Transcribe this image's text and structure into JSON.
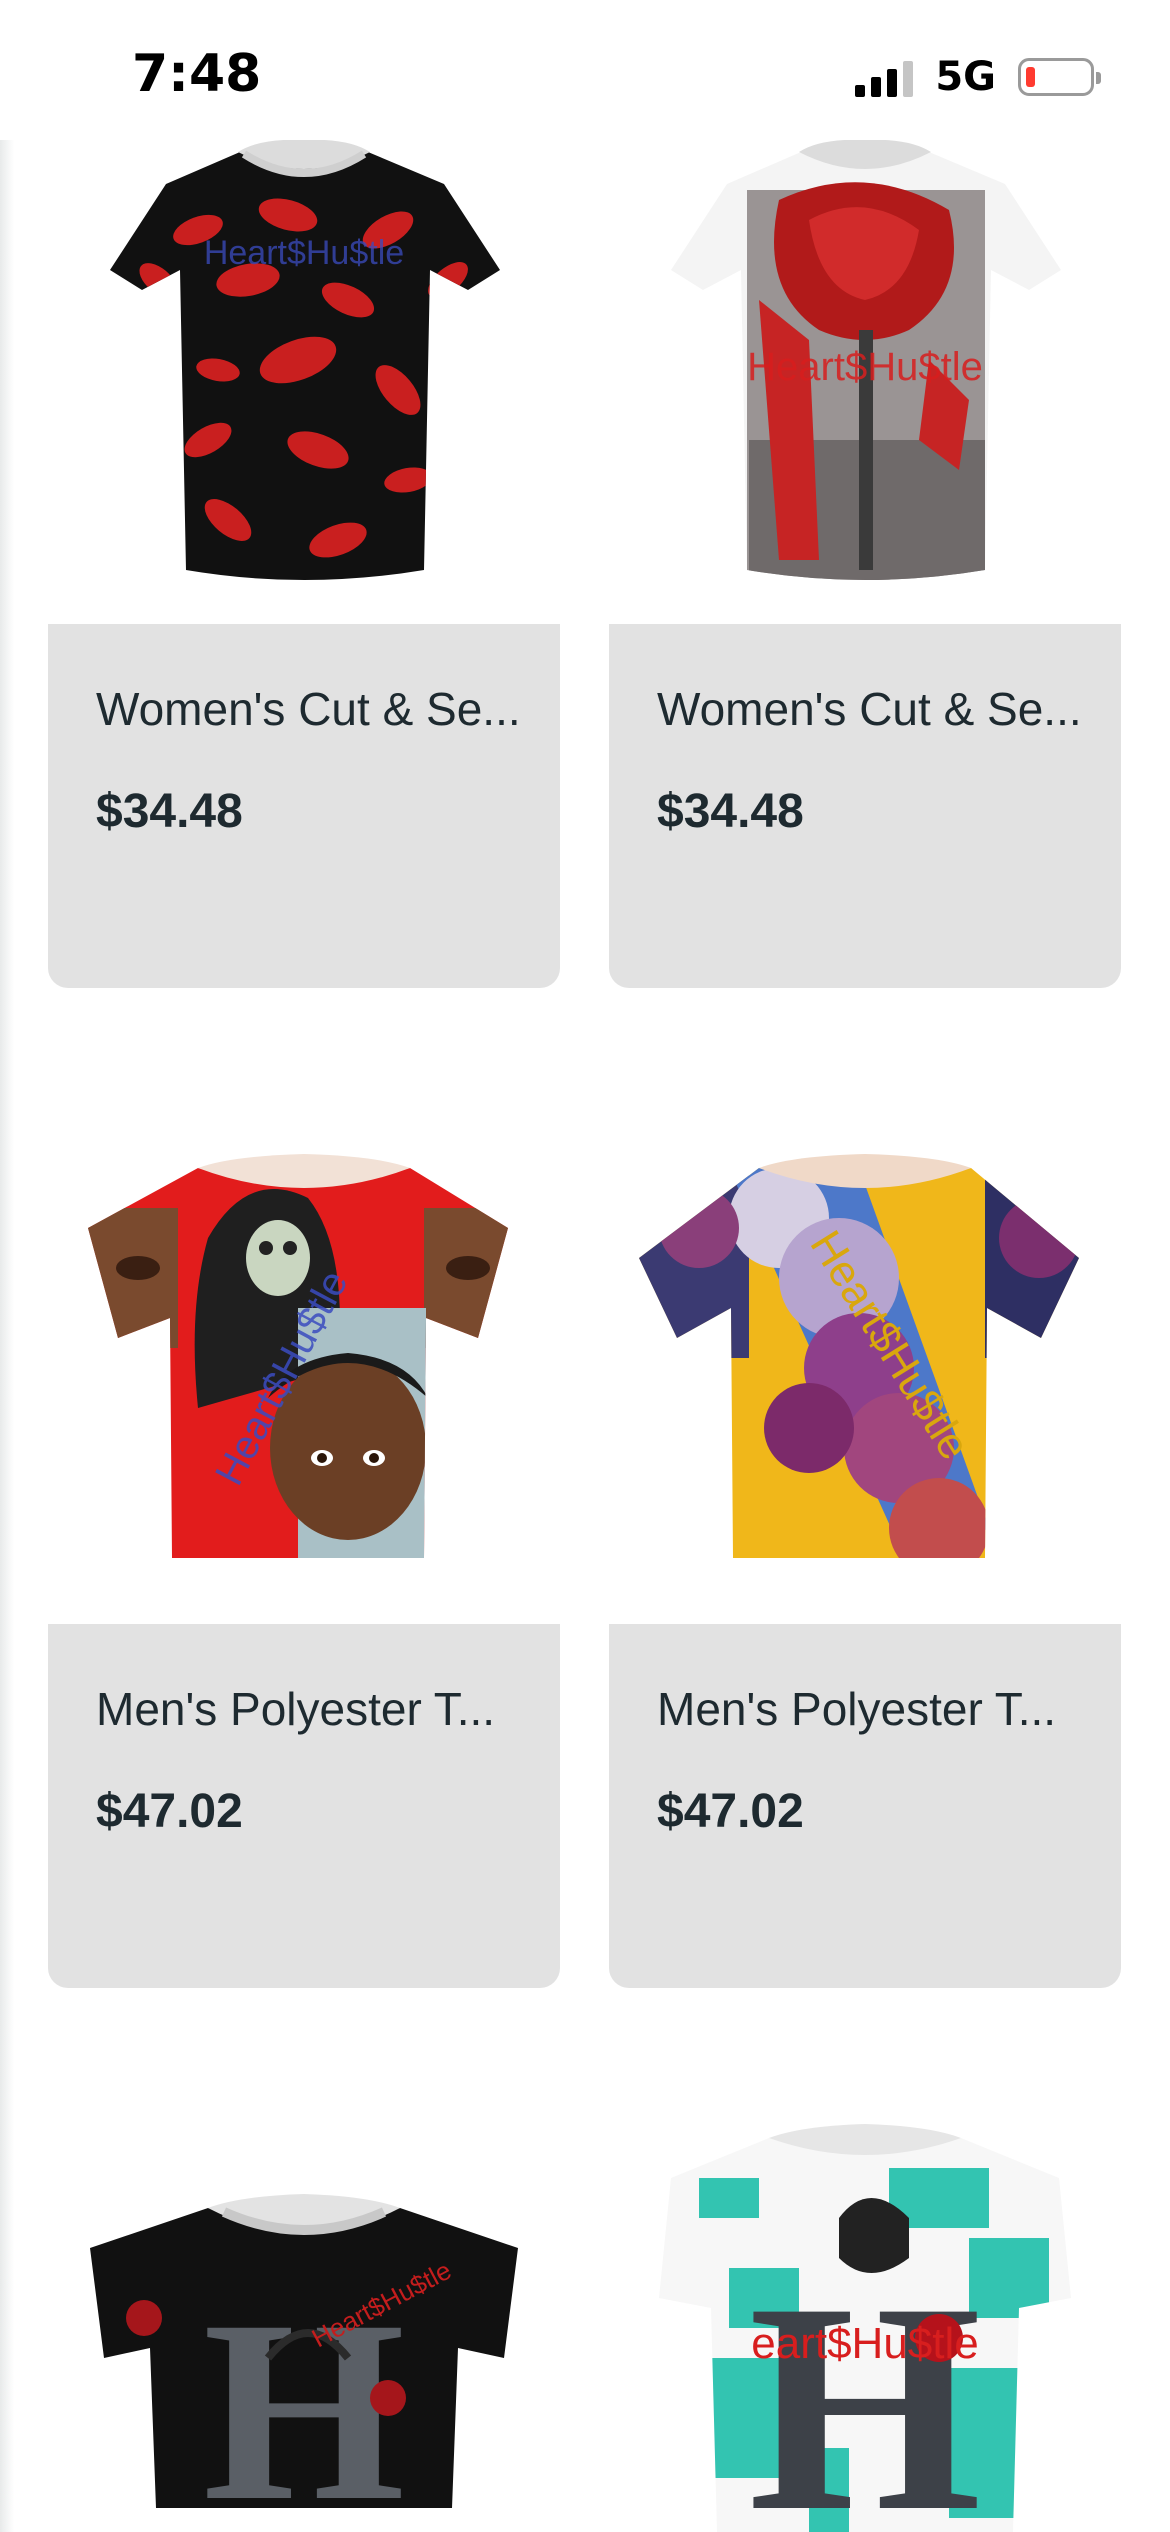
{
  "status_bar": {
    "time": "7:48",
    "network": "5G",
    "signal_bars": 3,
    "battery_level": 0.1,
    "icons": [
      "signal-icon",
      "battery-icon"
    ]
  },
  "products": [
    {
      "title": "Women's Cut & Se...",
      "price": "$34.48",
      "image": "red-lips-womens-tshirt",
      "print_text": "Heart$Hu$tle"
    },
    {
      "title": "Women's Cut & Se...",
      "price": "$34.48",
      "image": "red-rose-womens-tshirt",
      "print_text": "Heart$Hu$tle"
    },
    {
      "title": "Men's Polyester T...",
      "price": "$47.02",
      "image": "hooded-skeleton-boy-mens-tshirt",
      "print_text": "Heart$Hu$tle"
    },
    {
      "title": "Men's Polyester T...",
      "price": "$47.02",
      "image": "clouds-yellow-mens-tshirt",
      "print_text": "Heart$Hu$tle"
    },
    {
      "title": "",
      "price": "",
      "image": "black-letter-h-crop-tshirt",
      "print_text": "Heart$Hu$tle"
    },
    {
      "title": "",
      "price": "",
      "image": "teal-letter-h-rose-tshirt",
      "print_text": "eart$Hu$tle"
    }
  ],
  "colors": {
    "card_background": "#e2e2e2",
    "text": "#1e2a30",
    "battery_low": "#ff3b30",
    "brand_red": "#d81e1e",
    "brand_blue": "#3b4cc0",
    "brand_gold": "#d9a70d"
  }
}
